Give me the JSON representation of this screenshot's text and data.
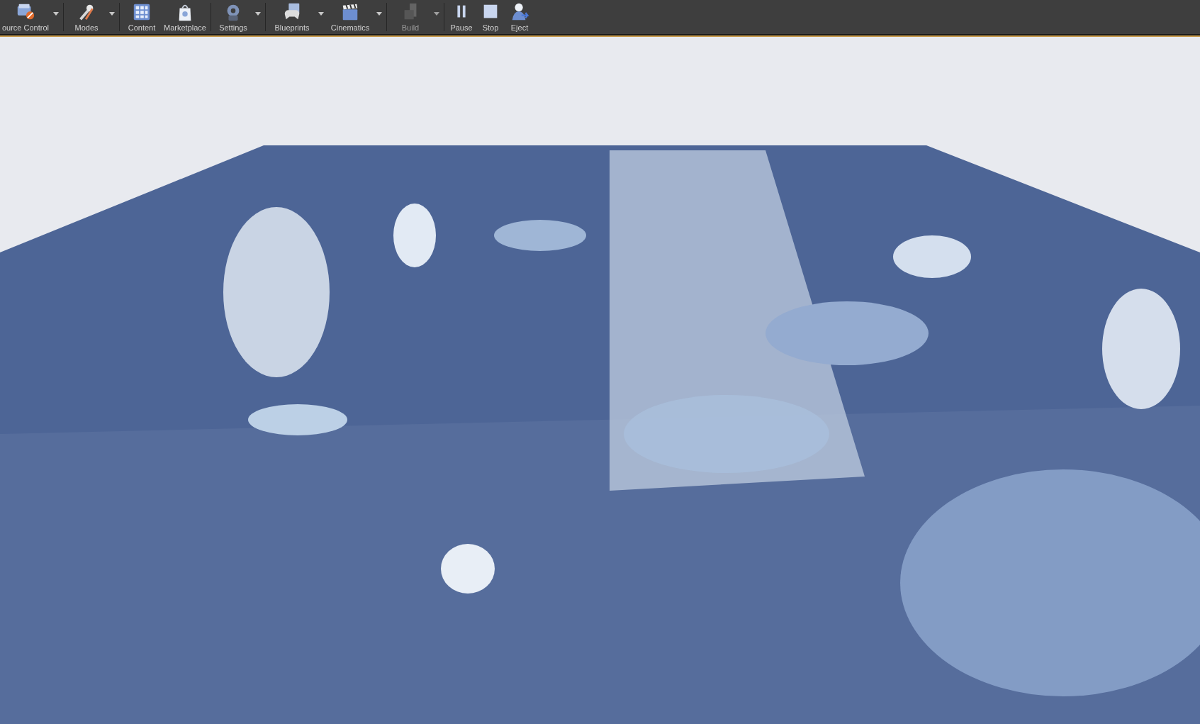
{
  "toolbar": {
    "groups": [
      {
        "buttons": [
          {
            "label": "ource Control",
            "kind": "source-control",
            "dropdown": true,
            "disabled": false
          }
        ]
      },
      {
        "buttons": [
          {
            "label": "Modes",
            "kind": "modes",
            "dropdown": true,
            "disabled": false
          }
        ]
      },
      {
        "buttons": [
          {
            "label": "Content",
            "kind": "content",
            "dropdown": false,
            "disabled": false
          },
          {
            "label": "Marketplace",
            "kind": "marketplace",
            "dropdown": false,
            "disabled": false
          }
        ]
      },
      {
        "buttons": [
          {
            "label": "Settings",
            "kind": "settings",
            "dropdown": true,
            "disabled": false
          }
        ]
      },
      {
        "buttons": [
          {
            "label": "Blueprints",
            "kind": "blueprints",
            "dropdown": true,
            "disabled": false
          },
          {
            "label": "Cinematics",
            "kind": "cinematics",
            "dropdown": true,
            "disabled": false
          }
        ]
      },
      {
        "buttons": [
          {
            "label": "Build",
            "kind": "build",
            "dropdown": true,
            "disabled": true
          }
        ]
      },
      {
        "buttons": [
          {
            "label": "Pause",
            "kind": "pause",
            "dropdown": false,
            "disabled": false
          },
          {
            "label": "Stop",
            "kind": "stop",
            "dropdown": false,
            "disabled": false
          },
          {
            "label": "Eject",
            "kind": "eject",
            "dropdown": false,
            "disabled": false
          }
        ]
      }
    ]
  }
}
